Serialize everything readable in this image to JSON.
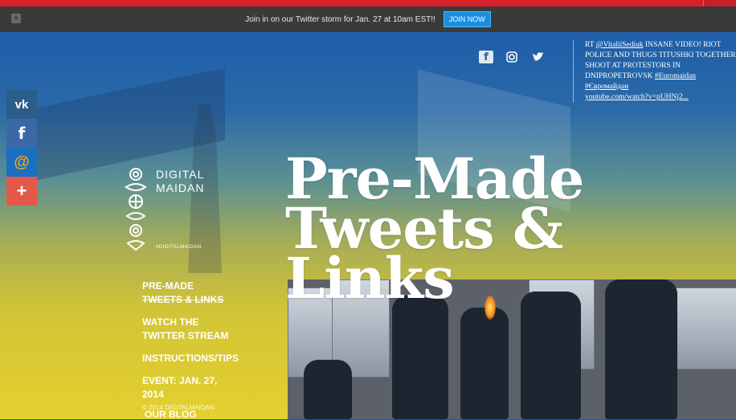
{
  "banner": {
    "text": "Join in on our Twitter storm for Jan. 27 at 10am EST!!",
    "button": "JOIN NOW"
  },
  "logo": {
    "line1": "DIGITAL",
    "line2": "MAIDAN",
    "hashtag": "#DIGITALMAIDAN"
  },
  "side_social": [
    "vk-icon",
    "facebook-icon",
    "email-icon",
    "share-plus-icon"
  ],
  "nav": {
    "items": [
      {
        "line1": "PRE-MADE",
        "line2": "TWEETS & LINKS"
      },
      {
        "line1": "WATCH THE",
        "line2": "TWITTER STREAM"
      },
      {
        "line1": "INSTRUCTIONS/TIPS",
        "line2": ""
      },
      {
        "line1": "EVENT: JAN. 27,",
        "line2": "2014"
      }
    ],
    "last": "OUR BLOG"
  },
  "copyright": "© 2014 DIGITALMAIDAN",
  "header_social": [
    "facebook-icon",
    "instagram-icon",
    "twitter-icon"
  ],
  "tweet": {
    "prefix": "RT ",
    "handle": "@VitaliiSediuk",
    "body": " INSANE VIDEO! RIOT POLICE AND THUGS TITUSHKI TOGETHER SHOOT AT PROTESTORS IN DNIPROPETROVSK ",
    "tag1": "#Euromaidan",
    "tag2": "#Євромайдан",
    "link": "youtube.com/watch?v=pUHNj2..."
  },
  "headline": {
    "line1": "Pre-Made",
    "line2": "Tweets &",
    "line3": "Links"
  }
}
